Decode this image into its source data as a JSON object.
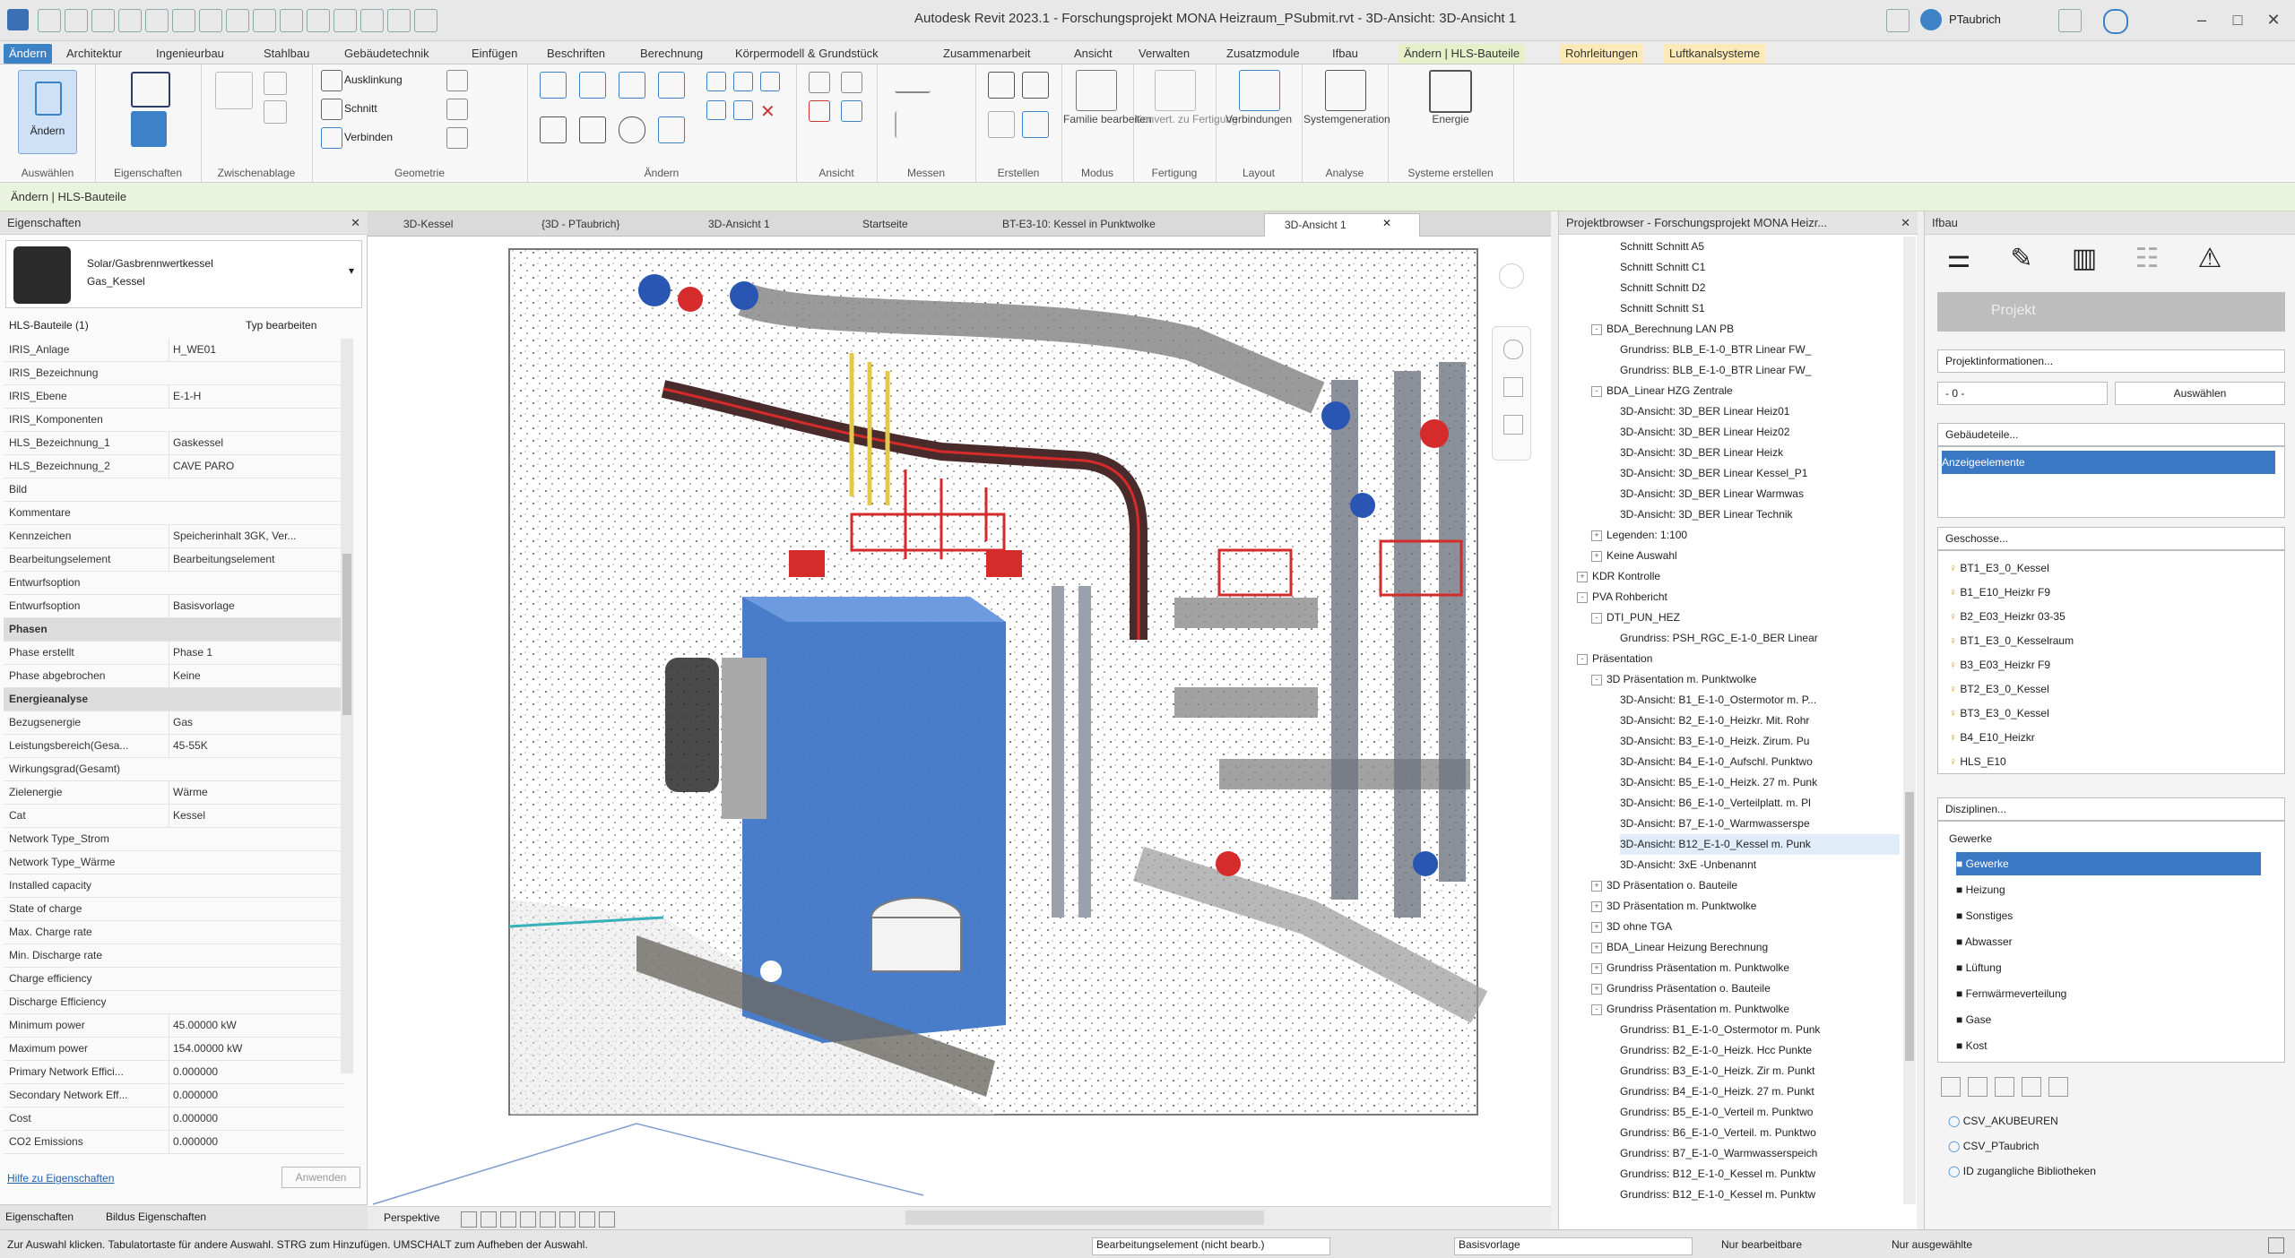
{
  "app": {
    "title": "Autodesk Revit 2023.1 - Forschungsprojekt MONA Heizraum_PSubmit.rvt - 3D-Ansicht: 3D-Ansicht 1",
    "user": "PTaubrich"
  },
  "ribbon_tabs": [
    "Ändern",
    "Architektur",
    "Ingenieurbau",
    "Stahlbau",
    "Gebäudetechnik",
    "Einfügen",
    "Beschriften",
    "Berechnung",
    "Körpermodell & Grundstück",
    "Zusammenarbeit",
    "Ansicht",
    "Verwalten",
    "Zusatzmodule",
    "Ifbau",
    "Ändern | HLS-Bauteile",
    "Rohrleitungen",
    "Luftkanalsysteme"
  ],
  "ribbon_groups": {
    "auswahlen": "Auswählen",
    "eigenschaften": "Eigenschaften",
    "zwischenablage": "Zwischenablage",
    "geometrie": "Geometrie",
    "andern": "Ändern",
    "ansicht": "Ansicht",
    "messen": "Messen",
    "erstellen": "Erstellen",
    "modus": "Modus",
    "fertigung": "Fertigung",
    "layout": "Layout",
    "analyse": "Analyse",
    "systemerstellen": "Systeme erstellen"
  },
  "ribbon_buttons": {
    "modify": "Ändern",
    "auswahlung": "Ausklinkung",
    "schnitt": "Schnitt",
    "verbinden": "Verbinden",
    "familie": "Familie bearbeiten",
    "fertigung_btn": "Konvert. zu Fertigung",
    "verbindungen": "Verbindungen",
    "systeme": "Systemgeneration",
    "energie": "Energie"
  },
  "options_bar": "Ändern | HLS-Bauteile",
  "properties": {
    "header": "Eigenschaften",
    "type_name": "Solar/Gasbrennwertkessel",
    "type_sub": "Gas_Kessel",
    "instance_filter": "HLS-Bauteile (1)",
    "edit_type": "Typ bearbeiten",
    "rows": [
      {
        "k": "IRIS_Anlage",
        "v": "H_WE01"
      },
      {
        "k": "IRIS_Bezeichnung",
        "v": ""
      },
      {
        "k": "IRIS_Ebene",
        "v": "E-1-H"
      },
      {
        "k": "IRIS_Komponenten",
        "v": ""
      },
      {
        "k": "HLS_Bezeichnung_1",
        "v": "Gaskessel"
      },
      {
        "k": "HLS_Bezeichnung_2",
        "v": "CAVE PARO"
      },
      {
        "k": "Bild",
        "v": ""
      },
      {
        "k": "Kommentare",
        "v": ""
      },
      {
        "k": "Kennzeichen",
        "v": "Speicherinhalt 3GK, Ver..."
      },
      {
        "k": "Bearbeitungselement",
        "v": "Bearbeitungselement"
      },
      {
        "k": "Entwurfsoption",
        "v": ""
      },
      {
        "k": "Entwurfsoption",
        "v": "Basisvorlage"
      }
    ],
    "sec_phasen": "Phasen",
    "phase_rows": [
      {
        "k": "Phase erstellt",
        "v": "Phase 1"
      },
      {
        "k": "Phase abgebrochen",
        "v": "Keine"
      }
    ],
    "sec_energie": "Energieanalyse",
    "energy_rows": [
      {
        "k": "Bezugsenergie",
        "v": "Gas"
      },
      {
        "k": "Leistungsbereich(Gesa...",
        "v": "45-55K"
      },
      {
        "k": "Wirkungsgrad(Gesamt)",
        "v": ""
      },
      {
        "k": "Zielenergie",
        "v": "Wärme"
      },
      {
        "k": "Cat",
        "v": "Kessel"
      },
      {
        "k": "Network Type_Strom",
        "v": ""
      },
      {
        "k": "Network Type_Wärme",
        "v": ""
      },
      {
        "k": "Installed capacity",
        "v": ""
      },
      {
        "k": "State of charge",
        "v": ""
      },
      {
        "k": "Max. Charge rate",
        "v": ""
      },
      {
        "k": "Min. Discharge rate",
        "v": ""
      },
      {
        "k": "Charge efficiency",
        "v": ""
      },
      {
        "k": "Discharge Efficiency",
        "v": ""
      },
      {
        "k": "Minimum power",
        "v": "45.00000 kW"
      },
      {
        "k": "Maximum power",
        "v": "154.00000 kW"
      },
      {
        "k": "Primary Network Effici...",
        "v": "0.000000"
      },
      {
        "k": "Secondary Network Eff...",
        "v": "0.000000"
      },
      {
        "k": "Cost",
        "v": "0.000000"
      },
      {
        "k": "CO2 Emissions",
        "v": "0.000000"
      }
    ],
    "help_link": "Hilfe zu Eigenschaften",
    "apply": "Anwenden",
    "bottom_tab1": "Eigenschaften",
    "bottom_tab2": "Bildus Eigenschaften"
  },
  "view_tabs": [
    "3D-Kessel",
    "{3D - PTaubrich}",
    "3D-Ansicht 1",
    "Startseite",
    "BT-E3-10: Kessel in Punktwolke",
    "3D-Ansicht 1"
  ],
  "view_bar": {
    "label": "Perspektive"
  },
  "browser": {
    "header": "Projektbrowser - Forschungsprojekt MONA Heizr...",
    "items": [
      {
        "d": 3,
        "t": "Schnitt Schnitt A5"
      },
      {
        "d": 3,
        "t": "Schnitt Schnitt C1"
      },
      {
        "d": 3,
        "t": "Schnitt Schnitt D2"
      },
      {
        "d": 3,
        "t": "Schnitt Schnitt S1"
      },
      {
        "d": 1,
        "t": "BDA_Berechnung LAN PB",
        "tog": "-"
      },
      {
        "d": 3,
        "t": "Grundriss: BLB_E-1-0_BTR Linear FW_"
      },
      {
        "d": 3,
        "t": "Grundriss: BLB_E-1-0_BTR Linear FW_"
      },
      {
        "d": 1,
        "t": "BDA_Linear HZG Zentrale",
        "tog": "-"
      },
      {
        "d": 3,
        "t": "3D-Ansicht: 3D_BER Linear Heiz01"
      },
      {
        "d": 3,
        "t": "3D-Ansicht: 3D_BER Linear Heiz02"
      },
      {
        "d": 3,
        "t": "3D-Ansicht: 3D_BER Linear Heizk"
      },
      {
        "d": 3,
        "t": "3D-Ansicht: 3D_BER Linear Kessel_P1"
      },
      {
        "d": 3,
        "t": "3D-Ansicht: 3D_BER Linear Warmwas"
      },
      {
        "d": 3,
        "t": "3D-Ansicht: 3D_BER Linear Technik"
      },
      {
        "d": 1,
        "t": "Legenden: 1:100",
        "tog": "+"
      },
      {
        "d": 1,
        "t": "Keine Auswahl",
        "tog": "+"
      },
      {
        "d": 0,
        "t": "KDR Kontrolle",
        "tog": "+"
      },
      {
        "d": 0,
        "t": "PVA Rohbericht",
        "tog": "-"
      },
      {
        "d": 1,
        "t": "DTI_PUN_HEZ",
        "tog": "-"
      },
      {
        "d": 3,
        "t": "Grundriss: PSH_RGC_E-1-0_BER Linear"
      },
      {
        "d": 0,
        "t": "Präsentation",
        "tog": "-"
      },
      {
        "d": 1,
        "t": "3D Präsentation m. Punktwolke",
        "tog": "-"
      },
      {
        "d": 3,
        "t": "3D-Ansicht: B1_E-1-0_Ostermotor m. P..."
      },
      {
        "d": 3,
        "t": "3D-Ansicht: B2_E-1-0_Heizkr. Mit. Rohr"
      },
      {
        "d": 3,
        "t": "3D-Ansicht: B3_E-1-0_Heizk. Zirum. Pu"
      },
      {
        "d": 3,
        "t": "3D-Ansicht: B4_E-1-0_Aufschl. Punktwo"
      },
      {
        "d": 3,
        "t": "3D-Ansicht: B5_E-1-0_Heizk. 27 m. Punk"
      },
      {
        "d": 3,
        "t": "3D-Ansicht: B6_E-1-0_Verteilplatt. m. Pl"
      },
      {
        "d": 3,
        "t": "3D-Ansicht: B7_E-1-0_Warmwasserspe"
      },
      {
        "d": 3,
        "t": "3D-Ansicht: B12_E-1-0_Kessel m. Punk"
      },
      {
        "d": 3,
        "t": "3D-Ansicht: 3xE -Unbenannt"
      },
      {
        "d": 1,
        "t": "3D Präsentation o. Bauteile",
        "tog": "+"
      },
      {
        "d": 1,
        "t": "3D Präsentation m. Punktwolke",
        "tog": "+"
      },
      {
        "d": 1,
        "t": "3D ohne TGA",
        "tog": "+"
      },
      {
        "d": 1,
        "t": "BDA_Linear Heizung Berechnung",
        "tog": "+"
      },
      {
        "d": 1,
        "t": "Grundriss Präsentation m. Punktwolke",
        "tog": "+"
      },
      {
        "d": 1,
        "t": "Grundriss Präsentation o. Bauteile",
        "tog": "+"
      },
      {
        "d": 1,
        "t": "Grundriss Präsentation m. Punktwolke",
        "tog": "-"
      },
      {
        "d": 3,
        "t": "Grundriss: B1_E-1-0_Ostermotor m. Punk"
      },
      {
        "d": 3,
        "t": "Grundriss: B2_E-1-0_Heizk. Hcc Punkte"
      },
      {
        "d": 3,
        "t": "Grundriss: B3_E-1-0_Heizk. Zir m. Punkt"
      },
      {
        "d": 3,
        "t": "Grundriss: B4_E-1-0_Heizk. 27 m. Punkt"
      },
      {
        "d": 3,
        "t": "Grundriss: B5_E-1-0_Verteil m. Punktwo"
      },
      {
        "d": 3,
        "t": "Grundriss: B6_E-1-0_Verteil. m. Punktwo"
      },
      {
        "d": 3,
        "t": "Grundriss: B7_E-1-0_Warmwasserspeich"
      },
      {
        "d": 3,
        "t": "Grundriss: B12_E-1-0_Kessel m. Punktw"
      },
      {
        "d": 3,
        "t": "Grundriss: B12_E-1-0_Kessel m. Punktw"
      }
    ]
  },
  "filters": {
    "header": "Ifbau",
    "project_label": "Projekt",
    "project_info": "Projektinformationen...",
    "select_value": "- 0 -",
    "select_button": "Auswählen",
    "group1_header": "Gebäudeteile...",
    "group1_item": "Anzeigeelemente",
    "group2_header": "Geschosse...",
    "levels": [
      "BT1_E3_0_Kessel",
      "B1_E10_Heizkr F9",
      "B2_E03_Heizkr 03-35",
      "BT1_E3_0_Kesselraum",
      "B3_E03_Heizkr F9",
      "BT2_E3_0_Kessel",
      "BT3_E3_0_Kessel",
      "B4_E10_Heizkr",
      "HLS_E10"
    ],
    "group3_header": "Disziplinen...",
    "disc_root": "Gewerke",
    "disciplines": [
      "Gewerke",
      "Heizung",
      "Sonstiges",
      "Abwasser",
      "Lüftung",
      "Fernwärmeverteilung",
      "Gase",
      "Kost"
    ],
    "bottom_items": [
      "CSV_AKUBEUREN",
      "CSV_PTaubrich",
      "ID zugangliche Bibliotheken"
    ]
  },
  "status": {
    "hint": "Zur Auswahl klicken. Tabulatortaste für andere Auswahl. STRG zum Hinzufügen. UMSCHALT zum Aufheben der Auswahl.",
    "workset": "Bearbeitungselement (nicht bearb.)",
    "design_option": "Basisvorlage",
    "editable_only": "Nur bearbeitbare",
    "press_drag": "Nur ausgewählte"
  },
  "colors": {
    "accent": "#3d82c7",
    "selection": "#3b78c4",
    "boiler": "#3f76c6",
    "pipe_red": "#d62b2b"
  }
}
